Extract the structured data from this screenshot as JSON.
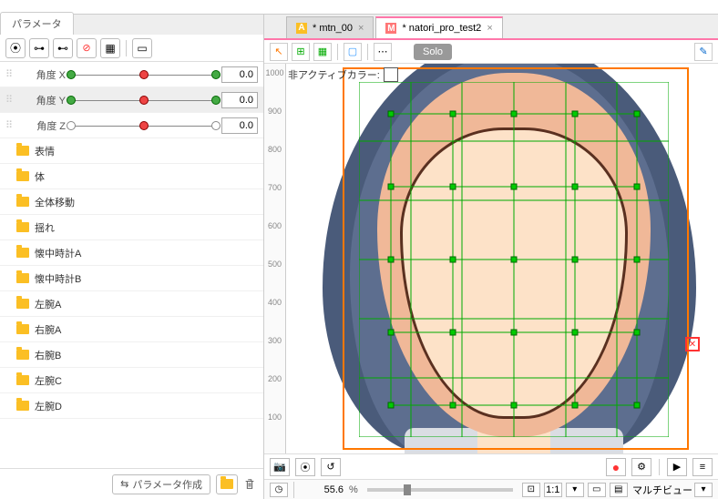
{
  "panel": {
    "title": "パラメータ"
  },
  "params": [
    {
      "label": "角度 X",
      "value": "0.0",
      "selected": false,
      "ticks": [
        {
          "p": 0,
          "c": "g"
        },
        {
          "p": 50,
          "c": "r"
        },
        {
          "p": 100,
          "c": "g"
        }
      ]
    },
    {
      "label": "角度 Y",
      "value": "0.0",
      "selected": true,
      "ticks": [
        {
          "p": 0,
          "c": "g"
        },
        {
          "p": 50,
          "c": "r"
        },
        {
          "p": 100,
          "c": "g"
        }
      ]
    },
    {
      "label": "角度 Z",
      "value": "0.0",
      "selected": false,
      "ticks": [
        {
          "p": 0,
          "c": "w"
        },
        {
          "p": 50,
          "c": "r"
        },
        {
          "p": 100,
          "c": "w"
        }
      ]
    }
  ],
  "folders": [
    "表情",
    "体",
    "全体移動",
    "揺れ",
    "懐中時計A",
    "懐中時計B",
    "左腕A",
    "右腕A",
    "右腕B",
    "左腕C",
    "左腕D"
  ],
  "actions": {
    "create_param": "パラメータ作成"
  },
  "tabs": [
    {
      "label": "* mtn_00",
      "active": false,
      "icon": "A",
      "icon_bg": "#fbbf24"
    },
    {
      "label": "* natori_pro_test2",
      "active": true,
      "icon": "M",
      "icon_bg": "#f77"
    }
  ],
  "canvas_toolbar": {
    "solo": "Solo"
  },
  "inactive_color_label": "非アクティブカラー:",
  "ruler_ticks": [
    1000,
    900,
    800,
    700,
    600,
    500,
    400,
    300,
    200,
    100
  ],
  "status": {
    "zoom": "55.6",
    "pct": "%",
    "ratio": "1:1",
    "multiview": "マルチビュー"
  }
}
